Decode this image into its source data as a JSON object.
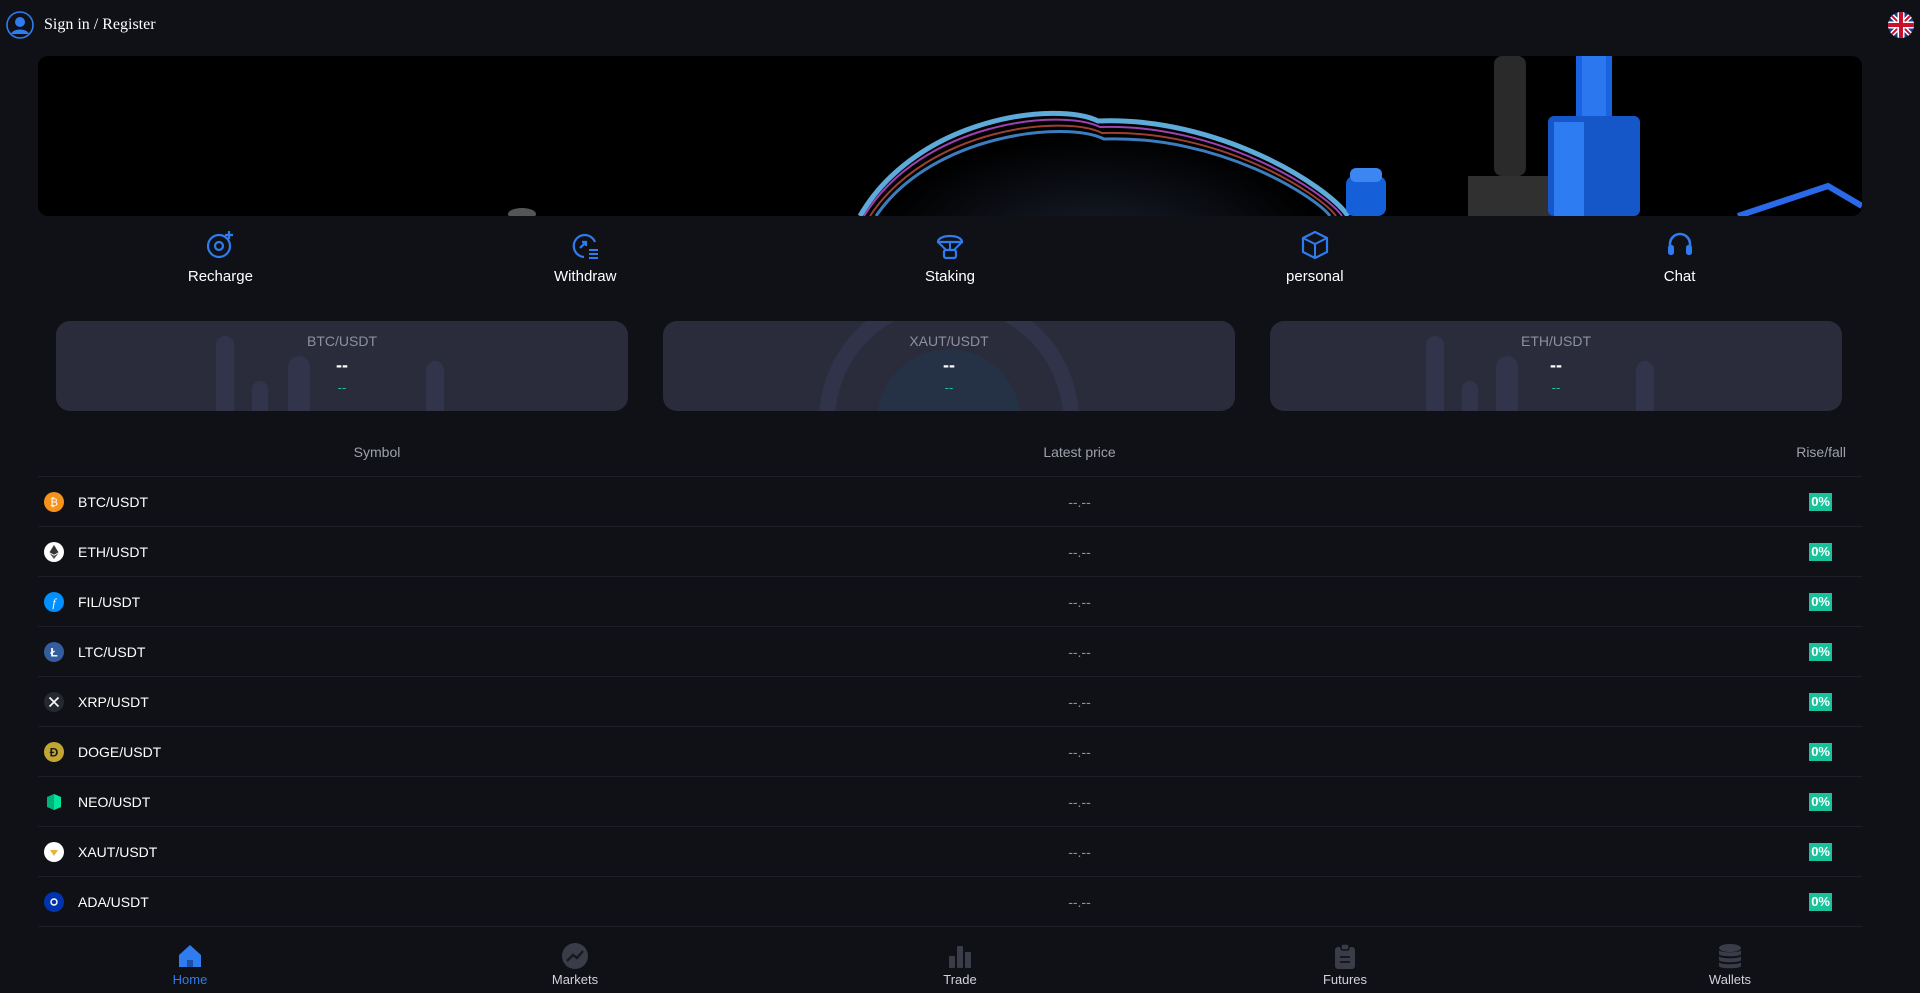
{
  "header": {
    "signin_label": "Sign in / Register",
    "avatar_icon": "user-avatar-icon",
    "language_icon": "uk-flag-icon"
  },
  "actions": [
    {
      "label": "Recharge",
      "icon": "recharge-icon"
    },
    {
      "label": "Withdraw",
      "icon": "withdraw-icon"
    },
    {
      "label": "Staking",
      "icon": "staking-icon"
    },
    {
      "label": "personal",
      "icon": "cube-icon"
    },
    {
      "label": "Chat",
      "icon": "headset-icon"
    }
  ],
  "cards": [
    {
      "symbol": "BTC/USDT",
      "price": "--",
      "change": "--"
    },
    {
      "symbol": "XAUT/USDT",
      "price": "--",
      "change": "--"
    },
    {
      "symbol": "ETH/USDT",
      "price": "--",
      "change": "--"
    }
  ],
  "table": {
    "headers": {
      "symbol": "Symbol",
      "price": "Latest price",
      "change": "Rise/fall"
    },
    "rows": [
      {
        "pair": "BTC/USDT",
        "price": "--.--",
        "change": "0%",
        "icon": "btc-icon",
        "color": "#f7931a"
      },
      {
        "pair": "ETH/USDT",
        "price": "--.--",
        "change": "0%",
        "icon": "eth-icon",
        "color": "#ffffff"
      },
      {
        "pair": "FIL/USDT",
        "price": "--.--",
        "change": "0%",
        "icon": "fil-icon",
        "color": "#0090ff"
      },
      {
        "pair": "LTC/USDT",
        "price": "--.--",
        "change": "0%",
        "icon": "ltc-icon",
        "color": "#345d9d"
      },
      {
        "pair": "XRP/USDT",
        "price": "--.--",
        "change": "0%",
        "icon": "xrp-icon",
        "color": "#23292f"
      },
      {
        "pair": "DOGE/USDT",
        "price": "--.--",
        "change": "0%",
        "icon": "doge-icon",
        "color": "#c2a633"
      },
      {
        "pair": "NEO/USDT",
        "price": "--.--",
        "change": "0%",
        "icon": "neo-icon",
        "color": "#00e599"
      },
      {
        "pair": "XAUT/USDT",
        "price": "--.--",
        "change": "0%",
        "icon": "xaut-icon",
        "color": "#ffffff"
      },
      {
        "pair": "ADA/USDT",
        "price": "--.--",
        "change": "0%",
        "icon": "ada-icon",
        "color": "#0033ad"
      }
    ]
  },
  "nav": [
    {
      "label": "Home",
      "icon": "home-icon",
      "active": true
    },
    {
      "label": "Markets",
      "icon": "markets-icon",
      "active": false
    },
    {
      "label": "Trade",
      "icon": "trade-icon",
      "active": false
    },
    {
      "label": "Futures",
      "icon": "futures-icon",
      "active": false
    },
    {
      "label": "Wallets",
      "icon": "wallets-icon",
      "active": false
    }
  ],
  "colors": {
    "accent": "#2f7bf0",
    "rise": "#19c29a",
    "background": "#0f1116",
    "card": "#2a2c3b"
  }
}
